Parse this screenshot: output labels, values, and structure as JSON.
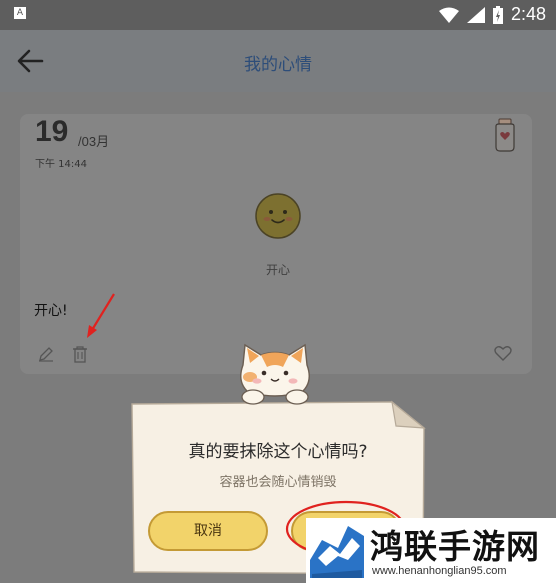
{
  "status_bar": {
    "indicator": "A",
    "time": "2:48"
  },
  "app_bar": {
    "title": "我的心情"
  },
  "card": {
    "day": "19",
    "month": "/03月",
    "time": "下午 14:44",
    "mood_label": "开心",
    "note": "开心!"
  },
  "dialog": {
    "title": "真的要抹除这个心情吗?",
    "subtitle": "容器也会随心情销毁",
    "cancel_label": "取消"
  },
  "watermark": {
    "title": "鸿联手游网",
    "url": "www.henanhonglian95.com"
  },
  "colors": {
    "appbar_title": "#2d4d79",
    "dialog_bg": "#f7f0e4",
    "button": "#f2d36a",
    "highlight": "#e0221f"
  }
}
